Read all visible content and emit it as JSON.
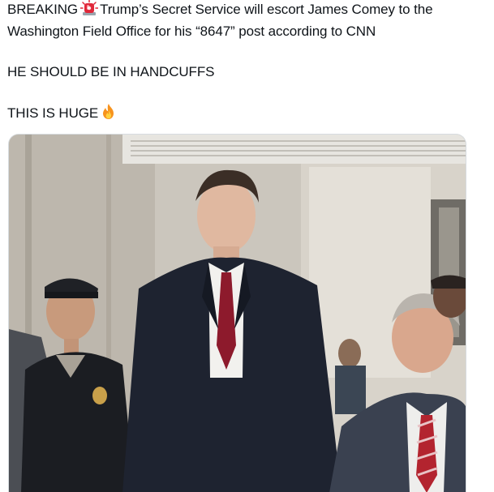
{
  "post": {
    "line1_word": "BREAKING",
    "line1_rest": "Trump’s Secret Service will escort James Comey to the",
    "line2": "Washington Field Office for his “8647” post according to CNN",
    "line3": "HE SHOULD BE IN HANDCUFFS",
    "line4": "THIS IS HUGE",
    "siren_icon": "police-light-emoji",
    "fire_icon": "fire-emoji"
  },
  "media": {
    "type": "photo",
    "subject": "man in dark suit and red tie walking in hallway flanked by officers"
  },
  "colors": {
    "text": "#0f1419",
    "background": "#ffffff",
    "border": "#d7dce0"
  }
}
